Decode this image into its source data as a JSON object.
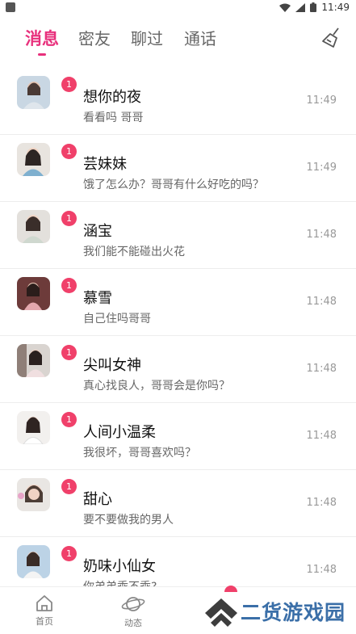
{
  "status_bar": {
    "time": "11:49"
  },
  "tabs": [
    {
      "label": "消息",
      "active": true
    },
    {
      "label": "密友",
      "active": false
    },
    {
      "label": "聊过",
      "active": false
    },
    {
      "label": "通话",
      "active": false
    }
  ],
  "conversations": [
    {
      "name": "想你的夜",
      "preview": "看看吗 哥哥",
      "time": "11:49",
      "unread": "1"
    },
    {
      "name": "芸妹妹",
      "preview": "饿了怎么办？哥哥有什么好吃的吗？",
      "time": "11:49",
      "unread": "1"
    },
    {
      "name": "涵宝",
      "preview": "我们能不能碰出火花",
      "time": "11:48",
      "unread": "1"
    },
    {
      "name": "慕雪",
      "preview": "自己住吗哥哥",
      "time": "11:48",
      "unread": "1"
    },
    {
      "name": "尖叫女神",
      "preview": "真心找良人，哥哥会是你吗？",
      "time": "11:48",
      "unread": "1"
    },
    {
      "name": "人间小温柔",
      "preview": "我很坏，哥哥喜欢吗？",
      "time": "11:48",
      "unread": "1"
    },
    {
      "name": "甜心",
      "preview": "要不要做我的男人",
      "time": "11:48",
      "unread": "1"
    },
    {
      "name": "奶味小仙女",
      "preview": "你弟弟乖不乖?",
      "time": "11:48",
      "unread": "1"
    }
  ],
  "bottom_nav": [
    {
      "label": "首页",
      "icon": "home-icon"
    },
    {
      "label": "动态",
      "icon": "planet-icon"
    }
  ],
  "watermark": {
    "text": "二货游戏园"
  },
  "colors": {
    "accent": "#e8307c",
    "badge": "#f0406a"
  }
}
